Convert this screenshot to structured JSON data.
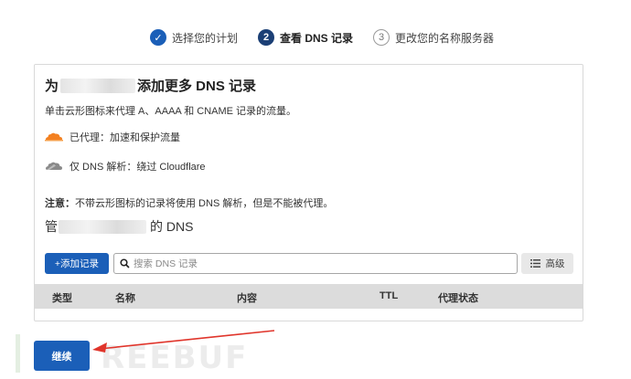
{
  "stepper": {
    "steps": [
      {
        "number": "✓",
        "label": "选择您的计划",
        "state": "done"
      },
      {
        "number": "2",
        "label": "查看 DNS 记录",
        "state": "current"
      },
      {
        "number": "3",
        "label": "更改您的名称服务器",
        "state": "todo"
      }
    ]
  },
  "card": {
    "title_prefix": "为",
    "title_suffix": "添加更多 DNS 记录",
    "description": "单击云形图标来代理 A、AAAA 和 CNAME 记录的流量。",
    "proxied_label": "已代理：加速和保护流量",
    "dns_only_label": "仅 DNS 解析：绕过 Cloudflare",
    "note_bold": "注意：",
    "note_text": "不带云形图标的记录将使用 DNS 解析，但是不能被代理。",
    "manage_prefix": "管",
    "manage_suffix": "的 DNS",
    "add_record_label": "+添加记录",
    "search_placeholder": "搜索 DNS 记录",
    "advanced_label": "高级",
    "table_headers": [
      "类型",
      "名称",
      "内容",
      "TTL",
      "代理状态"
    ]
  },
  "footer": {
    "continue_label": "继续",
    "watermark": "REEBUF"
  },
  "colors": {
    "primary": "#1b5fb8",
    "proxied_cloud": "#f38020",
    "dns_only_cloud": "#7a7a7a",
    "arrow": "#e0352b"
  }
}
